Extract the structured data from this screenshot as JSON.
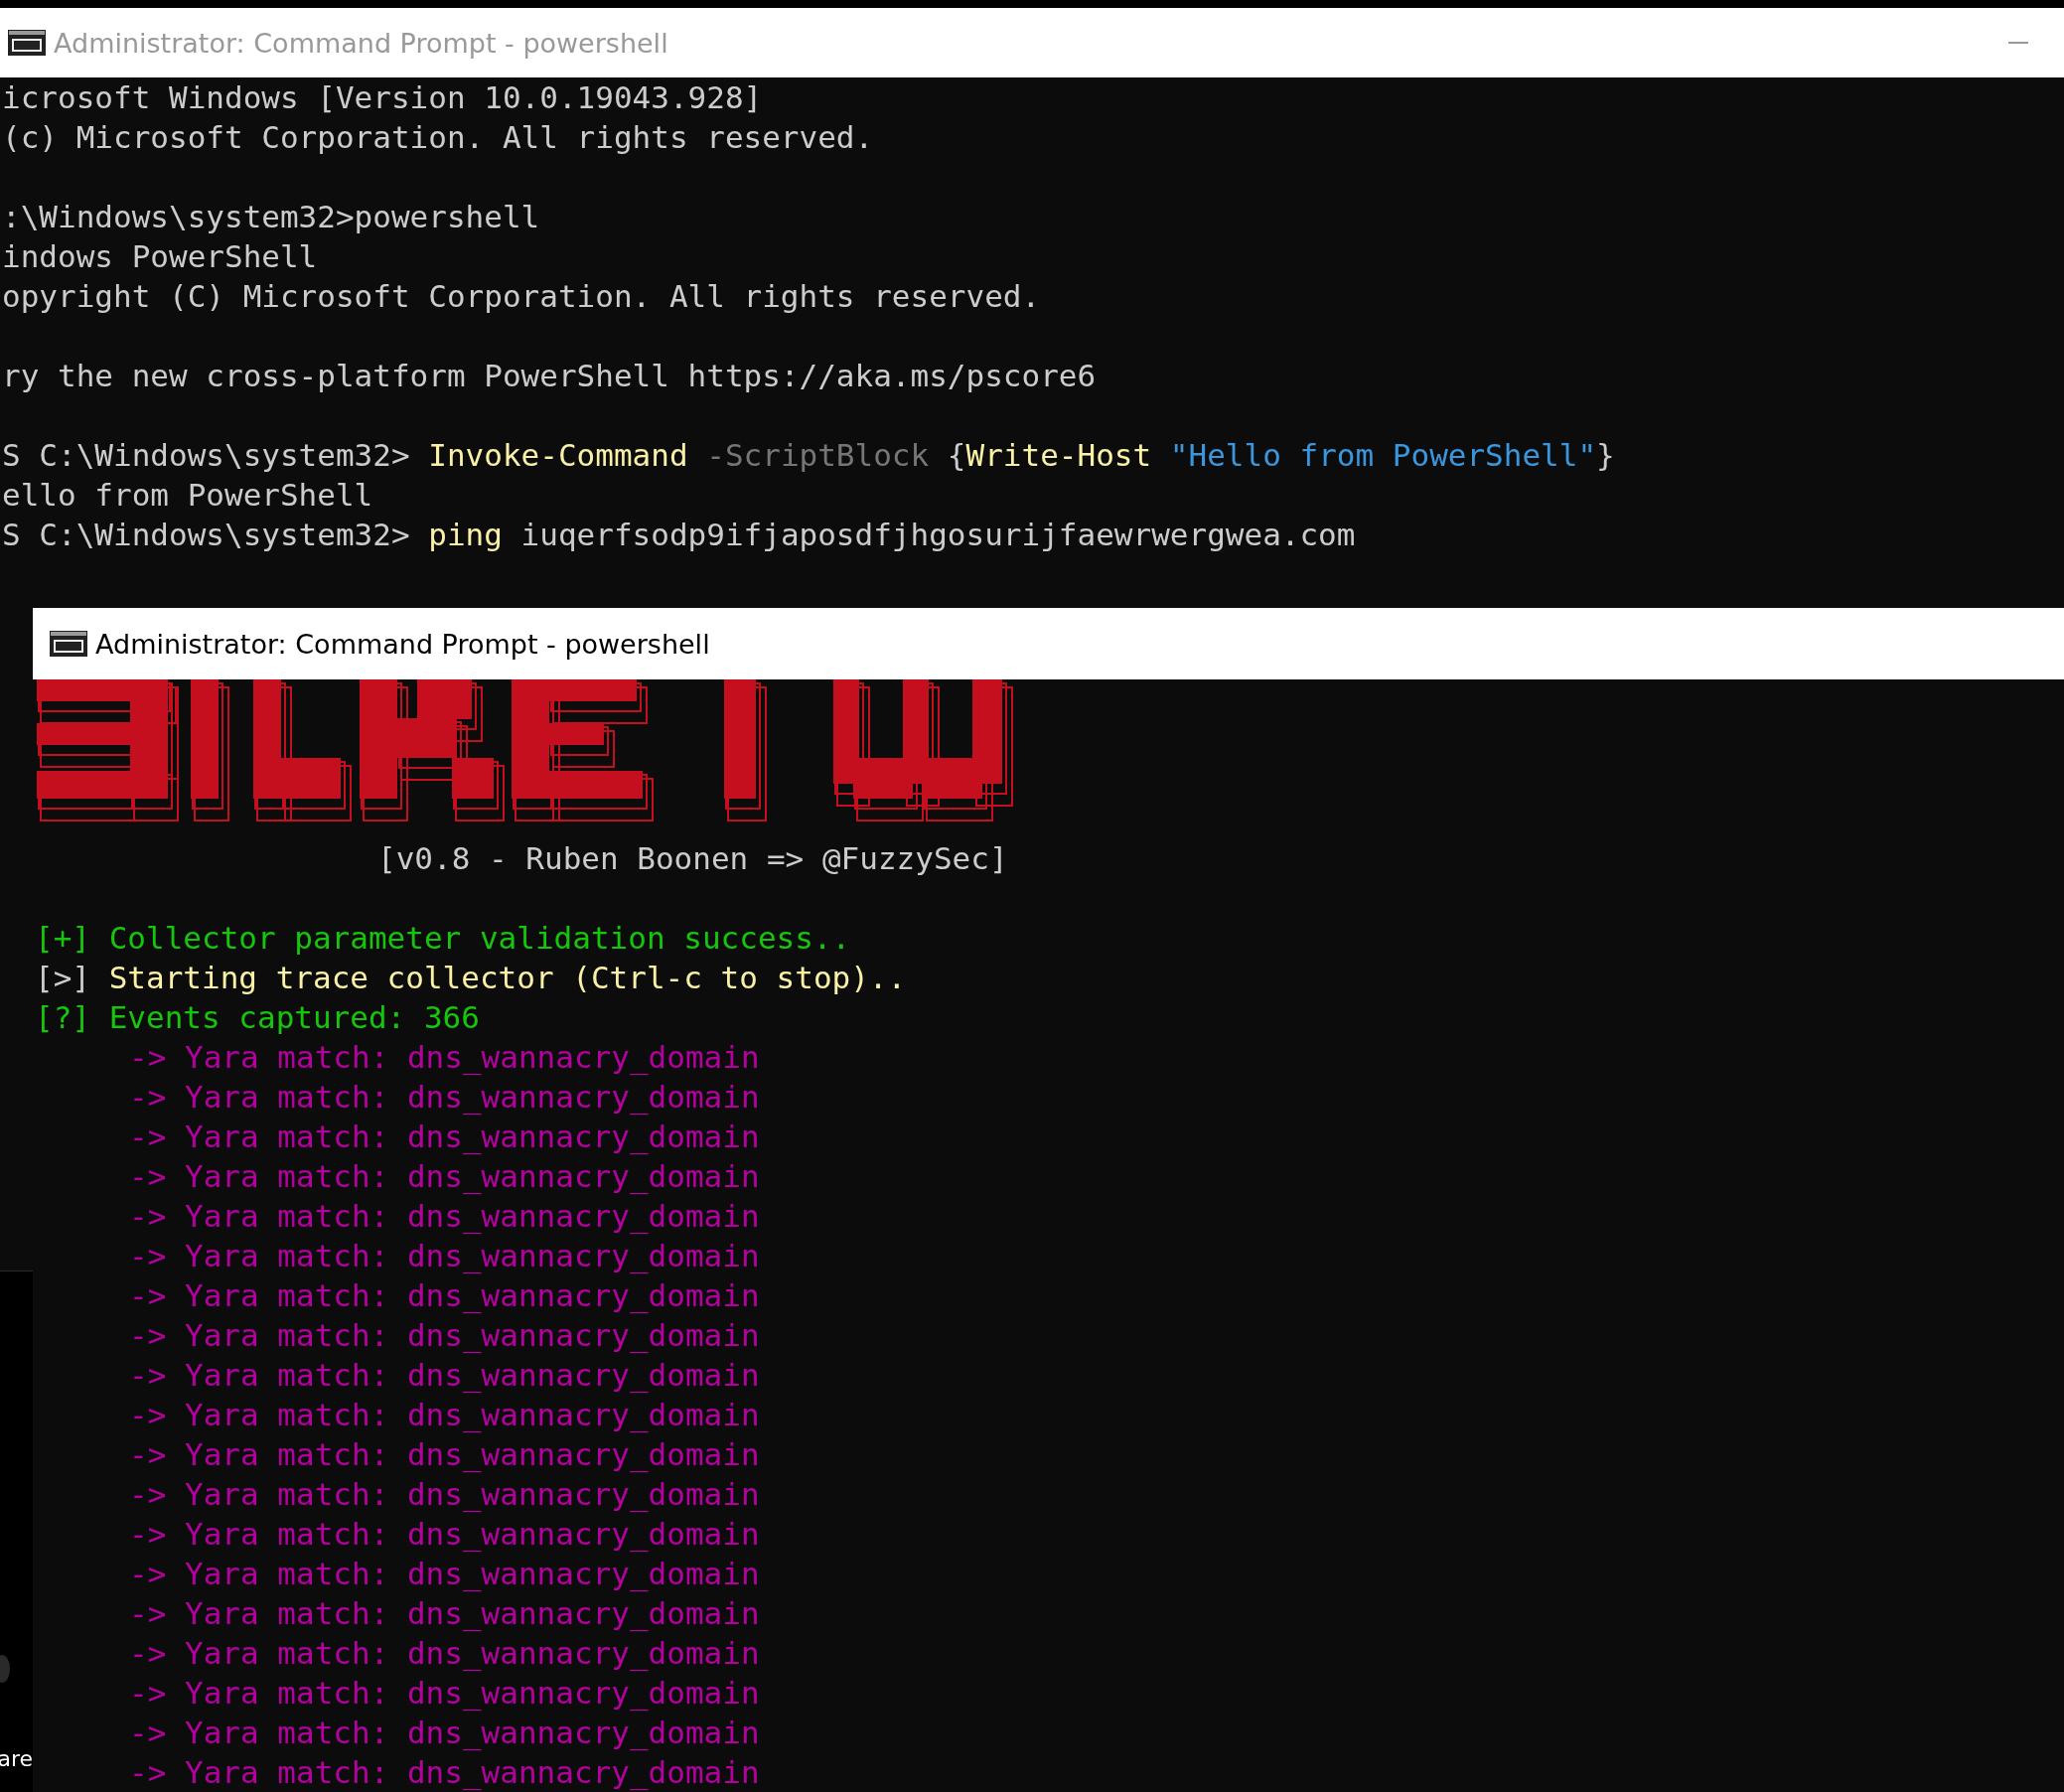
{
  "back_window": {
    "title": "Administrator: Command Prompt - powershell",
    "active": false,
    "lines": [
      {
        "kind": "text",
        "segments": [
          {
            "kind": "plain",
            "text": "icrosoft Windows [Version 10.0.19043.928]"
          }
        ]
      },
      {
        "kind": "text",
        "segments": [
          {
            "kind": "plain",
            "text": "(c) Microsoft Corporation. All rights reserved."
          }
        ]
      },
      {
        "kind": "blank"
      },
      {
        "kind": "text",
        "segments": [
          {
            "kind": "plain",
            "text": ":\\Windows\\system32>powershell"
          }
        ]
      },
      {
        "kind": "text",
        "segments": [
          {
            "kind": "plain",
            "text": "indows PowerShell"
          }
        ]
      },
      {
        "kind": "text",
        "segments": [
          {
            "kind": "plain",
            "text": "opyright (C) Microsoft Corporation. All rights reserved."
          }
        ]
      },
      {
        "kind": "blank"
      },
      {
        "kind": "text",
        "segments": [
          {
            "kind": "plain",
            "text": "ry the new cross-platform PowerShell https://aka.ms/pscore6"
          }
        ]
      },
      {
        "kind": "blank"
      },
      {
        "kind": "text",
        "segments": [
          {
            "kind": "plain",
            "text": "S C:\\Windows\\system32> "
          },
          {
            "kind": "command",
            "text": "Invoke-Command"
          },
          {
            "kind": "parameter",
            "text": " -ScriptBlock"
          },
          {
            "kind": "plain",
            "text": " {"
          },
          {
            "kind": "command",
            "text": "Write-Host"
          },
          {
            "kind": "string",
            "text": " \"Hello from PowerShell\""
          },
          {
            "kind": "plain",
            "text": "}"
          }
        ]
      },
      {
        "kind": "text",
        "segments": [
          {
            "kind": "plain",
            "text": "ello from PowerShell"
          }
        ]
      },
      {
        "kind": "text",
        "segments": [
          {
            "kind": "plain",
            "text": "S C:\\Windows\\system32> "
          },
          {
            "kind": "command",
            "text": "ping"
          },
          {
            "kind": "plain",
            "text": " iuqerfsodp9ifjaposdfjhgosurijfaewrwergwea.com"
          }
        ]
      }
    ]
  },
  "desktop": {
    "label": "are"
  },
  "front_window": {
    "title": "Administrator: Command Prompt - powershell",
    "active": true,
    "lines": [
      {
        "kind": "credit",
        "segments": [
          {
            "kind": "plain",
            "text": "[v0.8 - Ruben Boonen => @FuzzySec]"
          }
        ]
      },
      {
        "kind": "blank"
      },
      {
        "kind": "text",
        "segments": [
          {
            "kind": "success",
            "text": "[+] Collector parameter validation success.."
          }
        ]
      },
      {
        "kind": "text",
        "segments": [
          {
            "kind": "plain",
            "text": "[>]"
          },
          {
            "kind": "command",
            "text": " Starting trace collector (Ctrl-c to stop).."
          }
        ]
      },
      {
        "kind": "text",
        "segments": [
          {
            "kind": "success",
            "text": "[?] Events captured: 366"
          }
        ]
      },
      {
        "kind": "match",
        "segments": [
          {
            "kind": "match",
            "text": "-> Yara match: dns_wannacry_domain"
          }
        ]
      },
      {
        "kind": "match",
        "segments": [
          {
            "kind": "match",
            "text": "-> Yara match: dns_wannacry_domain"
          }
        ]
      },
      {
        "kind": "match",
        "segments": [
          {
            "kind": "match",
            "text": "-> Yara match: dns_wannacry_domain"
          }
        ]
      },
      {
        "kind": "match",
        "segments": [
          {
            "kind": "match",
            "text": "-> Yara match: dns_wannacry_domain"
          }
        ]
      },
      {
        "kind": "match",
        "segments": [
          {
            "kind": "match",
            "text": "-> Yara match: dns_wannacry_domain"
          }
        ]
      },
      {
        "kind": "match",
        "segments": [
          {
            "kind": "match",
            "text": "-> Yara match: dns_wannacry_domain"
          }
        ]
      },
      {
        "kind": "match",
        "segments": [
          {
            "kind": "match",
            "text": "-> Yara match: dns_wannacry_domain"
          }
        ]
      },
      {
        "kind": "match",
        "segments": [
          {
            "kind": "match",
            "text": "-> Yara match: dns_wannacry_domain"
          }
        ]
      },
      {
        "kind": "match",
        "segments": [
          {
            "kind": "match",
            "text": "-> Yara match: dns_wannacry_domain"
          }
        ]
      },
      {
        "kind": "match",
        "segments": [
          {
            "kind": "match",
            "text": "-> Yara match: dns_wannacry_domain"
          }
        ]
      },
      {
        "kind": "match",
        "segments": [
          {
            "kind": "match",
            "text": "-> Yara match: dns_wannacry_domain"
          }
        ]
      },
      {
        "kind": "match",
        "segments": [
          {
            "kind": "match",
            "text": "-> Yara match: dns_wannacry_domain"
          }
        ]
      },
      {
        "kind": "match",
        "segments": [
          {
            "kind": "match",
            "text": "-> Yara match: dns_wannacry_domain"
          }
        ]
      },
      {
        "kind": "match",
        "segments": [
          {
            "kind": "match",
            "text": "-> Yara match: dns_wannacry_domain"
          }
        ]
      },
      {
        "kind": "match",
        "segments": [
          {
            "kind": "match",
            "text": "-> Yara match: dns_wannacry_domain"
          }
        ]
      },
      {
        "kind": "match",
        "segments": [
          {
            "kind": "match",
            "text": "-> Yara match: dns_wannacry_domain"
          }
        ]
      },
      {
        "kind": "match",
        "segments": [
          {
            "kind": "match",
            "text": "-> Yara match: dns_wannacry_domain"
          }
        ]
      },
      {
        "kind": "match",
        "segments": [
          {
            "kind": "match",
            "text": "-> Yara match: dns_wannacry_domain"
          }
        ]
      },
      {
        "kind": "match",
        "segments": [
          {
            "kind": "match",
            "text": "-> Yara match: dns_wannacry_domain"
          }
        ]
      }
    ]
  }
}
